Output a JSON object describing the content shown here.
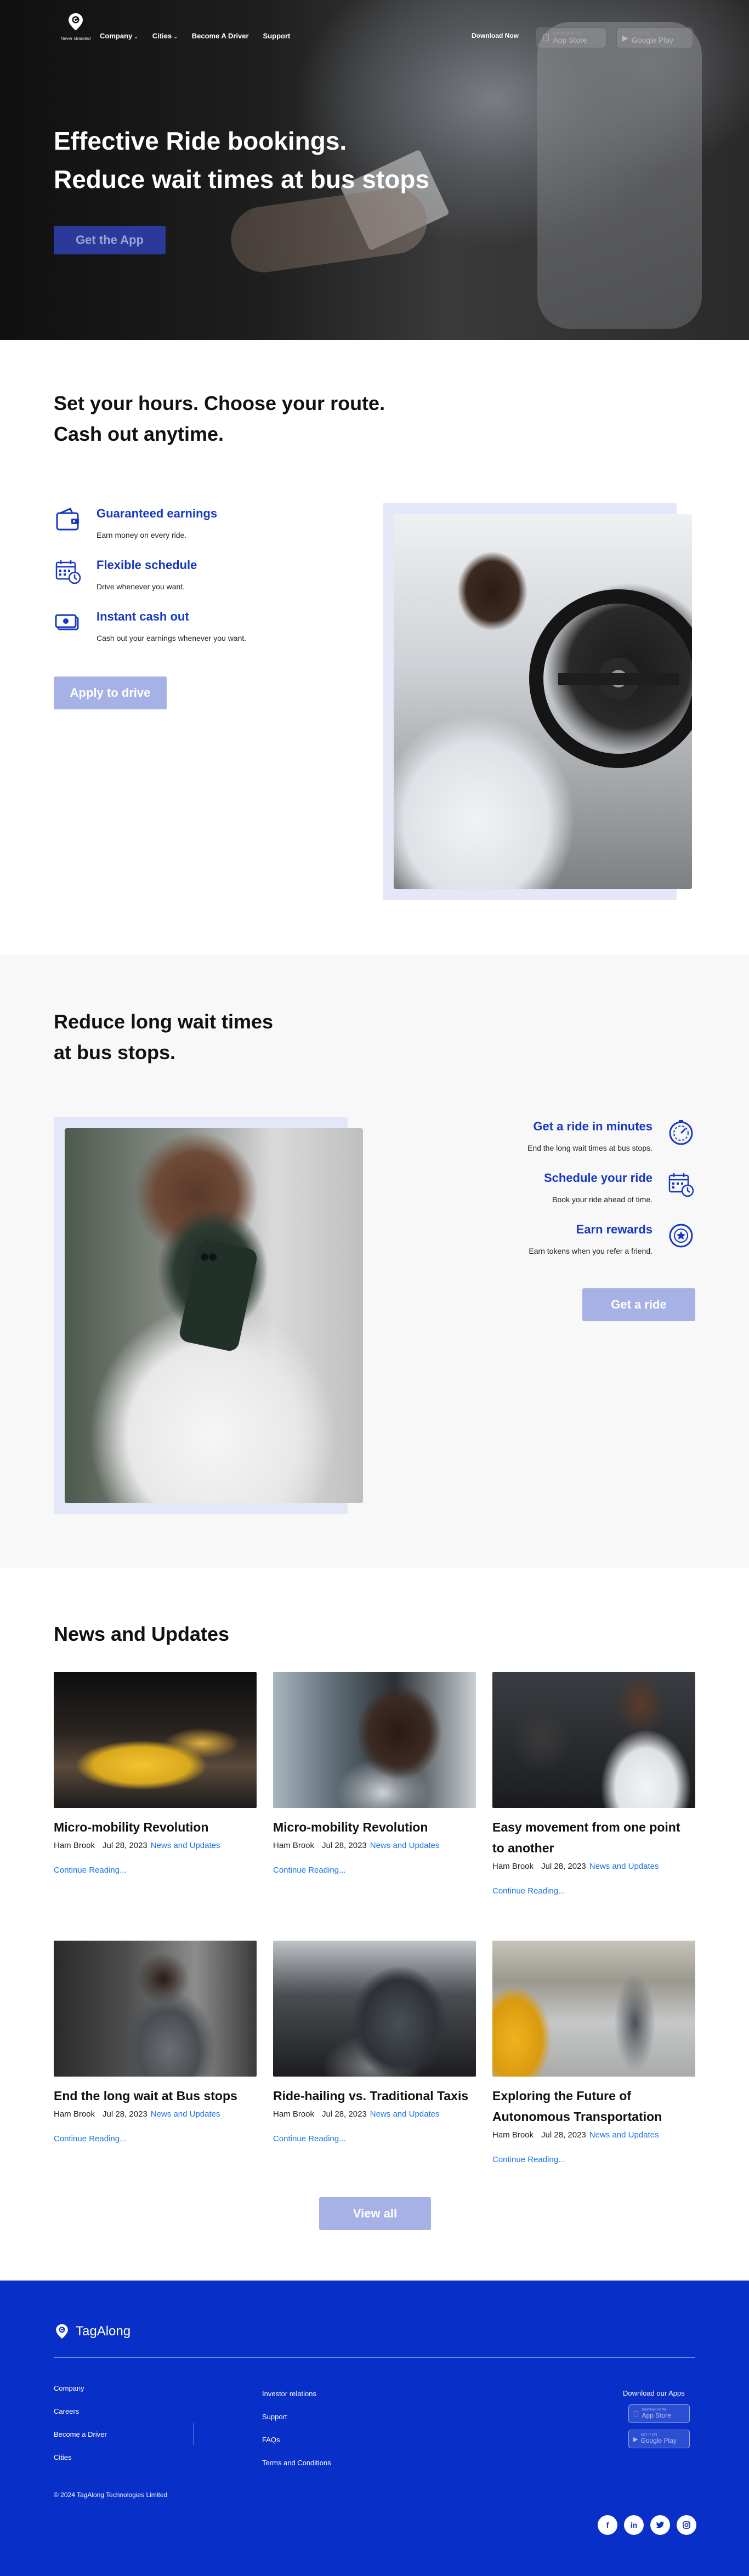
{
  "brand": {
    "name": "TagAlong",
    "tagline": "Never stranded",
    "colors": {
      "primary": "#0830c8",
      "accent": "#1737c4",
      "button": "#a6b2e6",
      "link": "#1a73e8"
    }
  },
  "nav": {
    "items": [
      {
        "label": "Company",
        "dropdown": true
      },
      {
        "label": "Cities",
        "dropdown": true
      },
      {
        "label": "Become A Driver",
        "dropdown": false
      },
      {
        "label": "Support",
        "dropdown": false
      }
    ],
    "download_now": "Download Now",
    "app_store": {
      "small": "Download on the",
      "big": "App Store",
      "icon": "apple-icon"
    },
    "google_play": {
      "small": "GET IT ON",
      "big": "Google Play",
      "icon": "play-icon"
    }
  },
  "hero": {
    "title_line1": "Effective Ride bookings.",
    "title_line2": "Reduce wait times at bus stops",
    "cta": "Get the App"
  },
  "drivers": {
    "title_line1": "Set your hours. Choose your route.",
    "title_line2": "Cash out anytime.",
    "features": [
      {
        "title": "Guaranteed earnings",
        "desc": "Earn money on every ride.",
        "icon": "wallet-icon"
      },
      {
        "title": "Flexible schedule",
        "desc": "Drive whenever you want.",
        "icon": "calendar-clock-icon"
      },
      {
        "title": "Instant cash out",
        "desc": "Cash out your earnings whenever you want.",
        "icon": "cash-icon"
      }
    ],
    "cta": "Apply to drive"
  },
  "riders": {
    "title_line1": "Reduce long wait times",
    "title_line2": "at bus stops.",
    "features": [
      {
        "title": "Get a ride in minutes",
        "desc": "End the long wait times at bus stops.",
        "icon": "timer-icon"
      },
      {
        "title": "Schedule your ride",
        "desc": "Book your ride ahead of time.",
        "icon": "calendar-clock-icon"
      },
      {
        "title": "Earn rewards",
        "desc": "Earn tokens when you refer a friend.",
        "icon": "reward-badge-icon"
      }
    ],
    "cta": "Get a ride"
  },
  "news": {
    "title": "News and Updates",
    "cards": [
      {
        "title": "Micro-mobility Revolution",
        "author": "Ham Brook",
        "date": "Jul 28, 2023",
        "category": "News and Updates",
        "more": "Continue Reading..."
      },
      {
        "title": "Micro-mobility Revolution",
        "author": "Ham Brook",
        "date": "Jul 28, 2023",
        "category": "News and Updates",
        "more": "Continue Reading..."
      },
      {
        "title": "Easy movement from one point to another",
        "author": "Ham Brook",
        "date": "Jul 28, 2023",
        "category": "News and Updates",
        "more": "Continue Reading..."
      },
      {
        "title": "End the long wait at Bus stops",
        "author": "Ham Brook",
        "date": "Jul 28, 2023",
        "category": "News and Updates",
        "more": "Continue Reading..."
      },
      {
        "title": "Ride-hailing vs. Traditional Taxis",
        "author": "Ham Brook",
        "date": "Jul 28, 2023",
        "category": "News and Updates",
        "more": "Continue Reading..."
      },
      {
        "title": "Exploring the Future of Autonomous Transportation",
        "author": "Ham Brook",
        "date": "Jul 28, 2023",
        "category": "News and Updates",
        "more": "Continue Reading..."
      }
    ],
    "view_all": "View all"
  },
  "footer": {
    "logo": "TagAlong",
    "col1": [
      "Company",
      "Careers",
      "Become a Driver",
      "Cities"
    ],
    "col2": [
      "Investor relations",
      "Support",
      "FAQs",
      "Terms and Conditions"
    ],
    "download_label": "Download our Apps",
    "app_store": {
      "small": "Download on the",
      "big": "App Store"
    },
    "google_play": {
      "small": "GET IT ON",
      "big": "Google Play"
    },
    "copyright": "© 2024 TagAlong Technologies Limited",
    "social": [
      "facebook-icon",
      "linkedin-icon",
      "twitter-icon",
      "instagram-icon"
    ]
  }
}
